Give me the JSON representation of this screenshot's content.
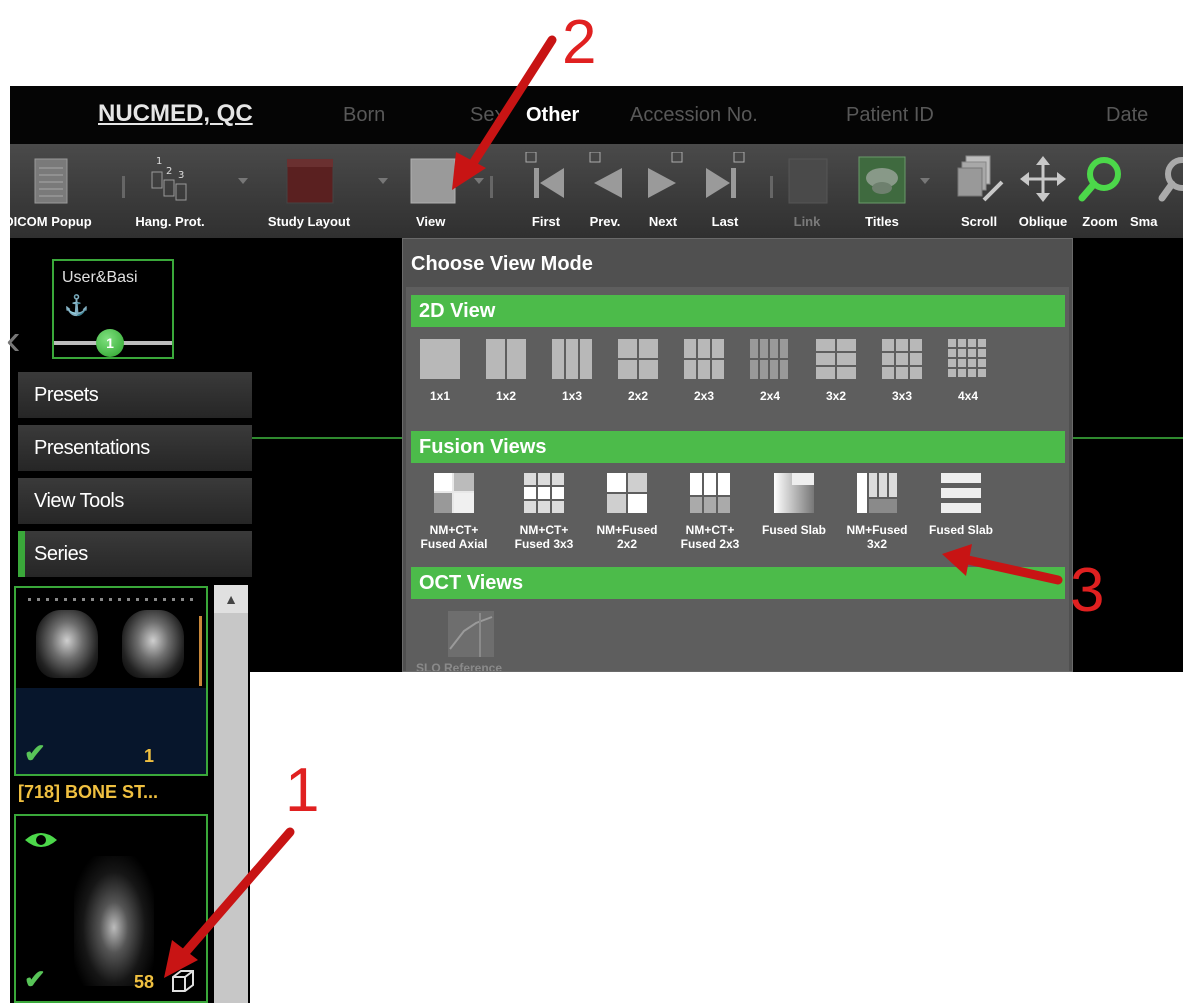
{
  "header": {
    "patient_name": "NUCMED, QC",
    "born_label": "Born",
    "sex_label": "Sex",
    "sex_value": "Other",
    "accession_label": "Accession No.",
    "patient_id_label": "Patient ID",
    "date_label": "Date"
  },
  "toolbar": {
    "dicom_popup": "DICOM Popup",
    "hang_prot": "Hang. Prot.",
    "study_layout": "Study Layout",
    "view": "View",
    "first": "First",
    "prev": "Prev.",
    "next": "Next",
    "last": "Last",
    "link": "Link",
    "titles": "Titles",
    "scroll": "Scroll",
    "oblique": "Oblique",
    "zoom": "Zoom",
    "smart": "Sma"
  },
  "left_panel": {
    "user_label": "User&Basi",
    "slider_value": "1",
    "presets": "Presets",
    "presentations": "Presentations",
    "view_tools": "View Tools",
    "series": "Series"
  },
  "series_list": {
    "thumb1_count": "1",
    "series_title": "[718] BONE ST...",
    "thumb2_count": "58"
  },
  "view_popup": {
    "title": "Choose View Mode",
    "section_2d": "2D View",
    "options_2d": [
      "1x1",
      "1x2",
      "1x3",
      "2x2",
      "2x3",
      "2x4",
      "3x2",
      "3x3",
      "4x4"
    ],
    "section_fusion": "Fusion Views",
    "options_fusion": [
      {
        "line1": "NM+CT+",
        "line2": "Fused Axial"
      },
      {
        "line1": "NM+CT+",
        "line2": "Fused 3x3"
      },
      {
        "line1": "NM+Fused",
        "line2": "2x2"
      },
      {
        "line1": "NM+CT+",
        "line2": "Fused 2x3"
      },
      {
        "line1": "Fused Slab",
        "line2": ""
      },
      {
        "line1": "NM+Fused",
        "line2": "3x2"
      },
      {
        "line1": "Fused Slab",
        "line2": ""
      }
    ],
    "section_oct": "OCT Views",
    "oct_option": "SLO Reference"
  },
  "annotations": {
    "step1": "1",
    "step2": "2",
    "step3": "3"
  },
  "colors": {
    "accent_green": "#4cbb4a",
    "series_title": "#f0c040",
    "annotation_red": "#e02020"
  }
}
